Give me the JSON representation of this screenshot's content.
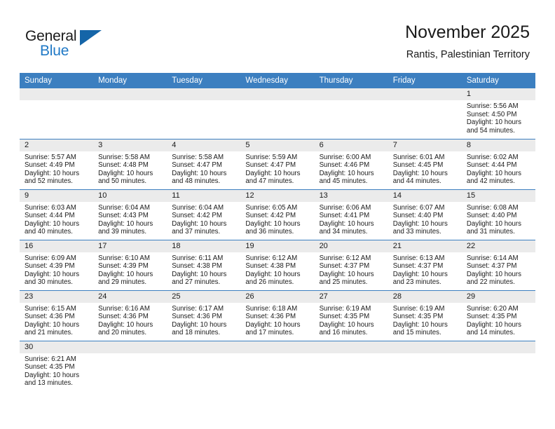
{
  "brand": {
    "name_part1": "General",
    "name_part2": "Blue",
    "logo_icon": "triangle-flag-icon",
    "accent_color": "#2079c6"
  },
  "header": {
    "title": "November 2025",
    "subtitle": "Rantis, Palestinian Territory"
  },
  "colors": {
    "header_row_bg": "#3c7fc0",
    "daynum_bg": "#ebebeb",
    "text": "#1a1a1a",
    "row_divider": "#3c7fc0"
  },
  "weekdays": [
    "Sunday",
    "Monday",
    "Tuesday",
    "Wednesday",
    "Thursday",
    "Friday",
    "Saturday"
  ],
  "weeks": [
    [
      {
        "day": "",
        "empty": true
      },
      {
        "day": "",
        "empty": true
      },
      {
        "day": "",
        "empty": true
      },
      {
        "day": "",
        "empty": true
      },
      {
        "day": "",
        "empty": true
      },
      {
        "day": "",
        "empty": true
      },
      {
        "day": "1",
        "sunrise": "Sunrise: 5:56 AM",
        "sunset": "Sunset: 4:50 PM",
        "daylight1": "Daylight: 10 hours",
        "daylight2": "and 54 minutes."
      }
    ],
    [
      {
        "day": "2",
        "sunrise": "Sunrise: 5:57 AM",
        "sunset": "Sunset: 4:49 PM",
        "daylight1": "Daylight: 10 hours",
        "daylight2": "and 52 minutes."
      },
      {
        "day": "3",
        "sunrise": "Sunrise: 5:58 AM",
        "sunset": "Sunset: 4:48 PM",
        "daylight1": "Daylight: 10 hours",
        "daylight2": "and 50 minutes."
      },
      {
        "day": "4",
        "sunrise": "Sunrise: 5:58 AM",
        "sunset": "Sunset: 4:47 PM",
        "daylight1": "Daylight: 10 hours",
        "daylight2": "and 48 minutes."
      },
      {
        "day": "5",
        "sunrise": "Sunrise: 5:59 AM",
        "sunset": "Sunset: 4:47 PM",
        "daylight1": "Daylight: 10 hours",
        "daylight2": "and 47 minutes."
      },
      {
        "day": "6",
        "sunrise": "Sunrise: 6:00 AM",
        "sunset": "Sunset: 4:46 PM",
        "daylight1": "Daylight: 10 hours",
        "daylight2": "and 45 minutes."
      },
      {
        "day": "7",
        "sunrise": "Sunrise: 6:01 AM",
        "sunset": "Sunset: 4:45 PM",
        "daylight1": "Daylight: 10 hours",
        "daylight2": "and 44 minutes."
      },
      {
        "day": "8",
        "sunrise": "Sunrise: 6:02 AM",
        "sunset": "Sunset: 4:44 PM",
        "daylight1": "Daylight: 10 hours",
        "daylight2": "and 42 minutes."
      }
    ],
    [
      {
        "day": "9",
        "sunrise": "Sunrise: 6:03 AM",
        "sunset": "Sunset: 4:44 PM",
        "daylight1": "Daylight: 10 hours",
        "daylight2": "and 40 minutes."
      },
      {
        "day": "10",
        "sunrise": "Sunrise: 6:04 AM",
        "sunset": "Sunset: 4:43 PM",
        "daylight1": "Daylight: 10 hours",
        "daylight2": "and 39 minutes."
      },
      {
        "day": "11",
        "sunrise": "Sunrise: 6:04 AM",
        "sunset": "Sunset: 4:42 PM",
        "daylight1": "Daylight: 10 hours",
        "daylight2": "and 37 minutes."
      },
      {
        "day": "12",
        "sunrise": "Sunrise: 6:05 AM",
        "sunset": "Sunset: 4:42 PM",
        "daylight1": "Daylight: 10 hours",
        "daylight2": "and 36 minutes."
      },
      {
        "day": "13",
        "sunrise": "Sunrise: 6:06 AM",
        "sunset": "Sunset: 4:41 PM",
        "daylight1": "Daylight: 10 hours",
        "daylight2": "and 34 minutes."
      },
      {
        "day": "14",
        "sunrise": "Sunrise: 6:07 AM",
        "sunset": "Sunset: 4:40 PM",
        "daylight1": "Daylight: 10 hours",
        "daylight2": "and 33 minutes."
      },
      {
        "day": "15",
        "sunrise": "Sunrise: 6:08 AM",
        "sunset": "Sunset: 4:40 PM",
        "daylight1": "Daylight: 10 hours",
        "daylight2": "and 31 minutes."
      }
    ],
    [
      {
        "day": "16",
        "sunrise": "Sunrise: 6:09 AM",
        "sunset": "Sunset: 4:39 PM",
        "daylight1": "Daylight: 10 hours",
        "daylight2": "and 30 minutes."
      },
      {
        "day": "17",
        "sunrise": "Sunrise: 6:10 AM",
        "sunset": "Sunset: 4:39 PM",
        "daylight1": "Daylight: 10 hours",
        "daylight2": "and 29 minutes."
      },
      {
        "day": "18",
        "sunrise": "Sunrise: 6:11 AM",
        "sunset": "Sunset: 4:38 PM",
        "daylight1": "Daylight: 10 hours",
        "daylight2": "and 27 minutes."
      },
      {
        "day": "19",
        "sunrise": "Sunrise: 6:12 AM",
        "sunset": "Sunset: 4:38 PM",
        "daylight1": "Daylight: 10 hours",
        "daylight2": "and 26 minutes."
      },
      {
        "day": "20",
        "sunrise": "Sunrise: 6:12 AM",
        "sunset": "Sunset: 4:37 PM",
        "daylight1": "Daylight: 10 hours",
        "daylight2": "and 25 minutes."
      },
      {
        "day": "21",
        "sunrise": "Sunrise: 6:13 AM",
        "sunset": "Sunset: 4:37 PM",
        "daylight1": "Daylight: 10 hours",
        "daylight2": "and 23 minutes."
      },
      {
        "day": "22",
        "sunrise": "Sunrise: 6:14 AM",
        "sunset": "Sunset: 4:37 PM",
        "daylight1": "Daylight: 10 hours",
        "daylight2": "and 22 minutes."
      }
    ],
    [
      {
        "day": "23",
        "sunrise": "Sunrise: 6:15 AM",
        "sunset": "Sunset: 4:36 PM",
        "daylight1": "Daylight: 10 hours",
        "daylight2": "and 21 minutes."
      },
      {
        "day": "24",
        "sunrise": "Sunrise: 6:16 AM",
        "sunset": "Sunset: 4:36 PM",
        "daylight1": "Daylight: 10 hours",
        "daylight2": "and 20 minutes."
      },
      {
        "day": "25",
        "sunrise": "Sunrise: 6:17 AM",
        "sunset": "Sunset: 4:36 PM",
        "daylight1": "Daylight: 10 hours",
        "daylight2": "and 18 minutes."
      },
      {
        "day": "26",
        "sunrise": "Sunrise: 6:18 AM",
        "sunset": "Sunset: 4:36 PM",
        "daylight1": "Daylight: 10 hours",
        "daylight2": "and 17 minutes."
      },
      {
        "day": "27",
        "sunrise": "Sunrise: 6:19 AM",
        "sunset": "Sunset: 4:35 PM",
        "daylight1": "Daylight: 10 hours",
        "daylight2": "and 16 minutes."
      },
      {
        "day": "28",
        "sunrise": "Sunrise: 6:19 AM",
        "sunset": "Sunset: 4:35 PM",
        "daylight1": "Daylight: 10 hours",
        "daylight2": "and 15 minutes."
      },
      {
        "day": "29",
        "sunrise": "Sunrise: 6:20 AM",
        "sunset": "Sunset: 4:35 PM",
        "daylight1": "Daylight: 10 hours",
        "daylight2": "and 14 minutes."
      }
    ],
    [
      {
        "day": "30",
        "sunrise": "Sunrise: 6:21 AM",
        "sunset": "Sunset: 4:35 PM",
        "daylight1": "Daylight: 10 hours",
        "daylight2": "and 13 minutes."
      },
      {
        "day": "",
        "empty": true
      },
      {
        "day": "",
        "empty": true
      },
      {
        "day": "",
        "empty": true
      },
      {
        "day": "",
        "empty": true
      },
      {
        "day": "",
        "empty": true
      },
      {
        "day": "",
        "empty": true
      }
    ]
  ]
}
